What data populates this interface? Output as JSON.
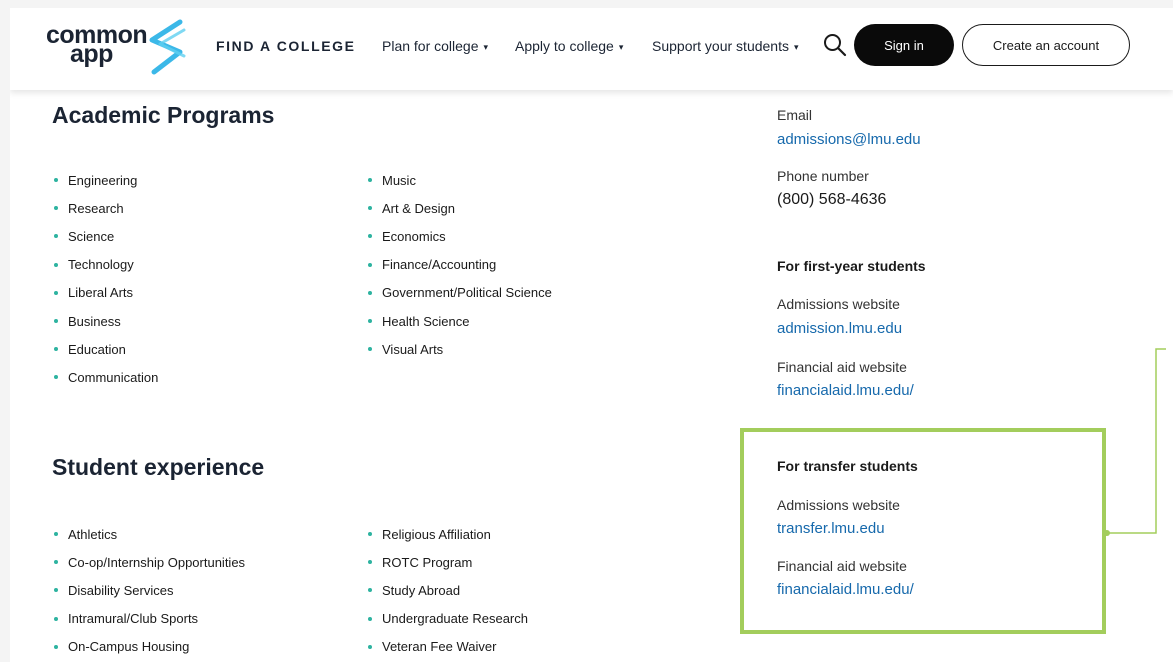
{
  "logo": {
    "line1": "common",
    "line2": "app"
  },
  "nav": {
    "find_college": "FIND A COLLEGE",
    "plan": "Plan for college",
    "apply": "Apply to college",
    "support": "Support your students",
    "caret": "▾",
    "sign_in": "Sign in",
    "create_account": "Create an account"
  },
  "academic": {
    "title": "Academic Programs",
    "col1": [
      "Engineering",
      "Research",
      "Science",
      "Technology",
      "Liberal Arts",
      "Business",
      "Education",
      "Communication"
    ],
    "col2": [
      "Music",
      "Art & Design",
      "Economics",
      "Finance/Accounting",
      "Government/Political Science",
      "Health Science",
      "Visual Arts"
    ]
  },
  "experience": {
    "title": "Student experience",
    "col1": [
      "Athletics",
      "Co-op/Internship Opportunities",
      "Disability Services",
      "Intramural/Club Sports",
      "On-Campus Housing"
    ],
    "col2": [
      "Religious Affiliation",
      "ROTC Program",
      "Study Abroad",
      "Undergraduate Research",
      "Veteran Fee Waiver"
    ]
  },
  "contact": {
    "email_label": "Email",
    "email": "admissions@lmu.edu",
    "phone_label": "Phone number",
    "phone": "(800) 568-4636",
    "first_year": {
      "heading": "For first-year students",
      "admissions_label": "Admissions website",
      "admissions_url": "admission.lmu.edu",
      "aid_label": "Financial aid website",
      "aid_url": "financialaid.lmu.edu/"
    },
    "transfer": {
      "heading": "For transfer students",
      "admissions_label": "Admissions website",
      "admissions_url": "transfer.lmu.edu",
      "aid_label": "Financial aid website",
      "aid_url": "financialaid.lmu.edu/"
    }
  },
  "colors": {
    "bullet": "#2db3a0",
    "link": "#1669ac",
    "highlight": "#a3cd5c",
    "logo_swoosh": "#3bb8e8"
  },
  "icons": {
    "search": "search-icon",
    "logo_mark": "logo-swoosh-icon"
  }
}
